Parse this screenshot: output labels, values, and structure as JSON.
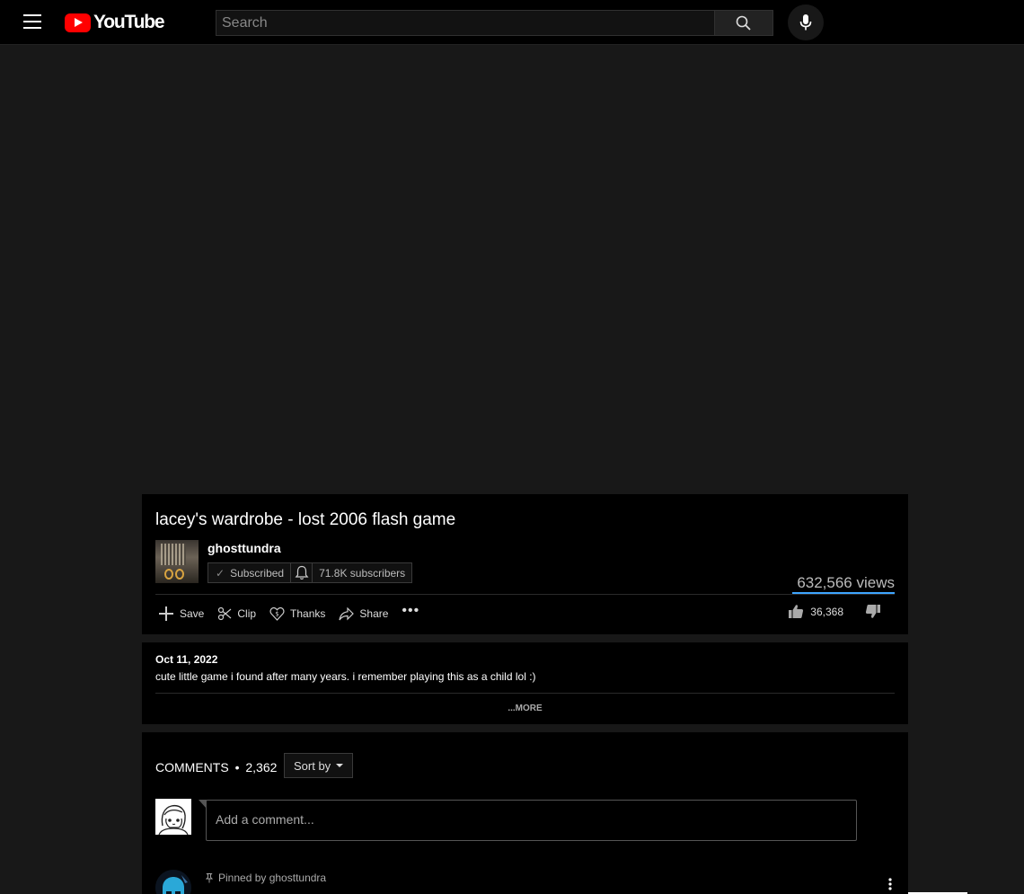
{
  "header": {
    "logo_text": "YouTube",
    "search_placeholder": "Search"
  },
  "video": {
    "title": "lacey's wardrobe - lost 2006 flash game",
    "channel_name": "ghosttundra",
    "subscribe_label": "Subscribed",
    "subscriber_count": "71.8K subscribers",
    "views": "632,566 views",
    "like_count": "36,368",
    "actions": [
      {
        "label": "Save",
        "icon": "plus-icon"
      },
      {
        "label": "Clip",
        "icon": "scissors-icon"
      },
      {
        "label": "Thanks",
        "icon": "thanks-icon"
      },
      {
        "label": "Share",
        "icon": "share-icon"
      }
    ],
    "more_label": "•••"
  },
  "description": {
    "date": "Oct 11, 2022",
    "text": "cute little game i found after many years. i remember playing this as a child lol :)",
    "more_label": "...MORE"
  },
  "comments": {
    "label": "COMMENTS",
    "separator": "•",
    "count": "2,362",
    "sort_label": "Sort by",
    "add_placeholder": "Add a comment...",
    "pinned_label": "Pinned by ghosttundra"
  },
  "colors": {
    "accent": "#3ea6ff",
    "brand": "#ff0000",
    "background": "#181818",
    "card": "#000000"
  }
}
